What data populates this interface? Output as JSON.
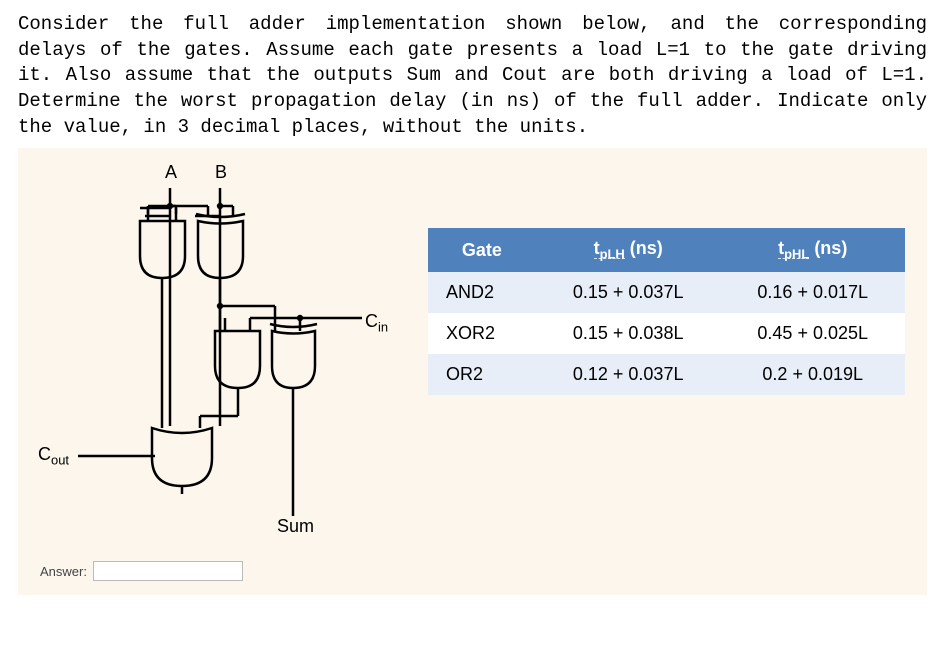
{
  "question": "Consider the full adder implementation shown below, and the corresponding delays of the gates. Assume each gate presents a load L=1 to the gate driving it. Also assume that the outputs Sum and Cout are both driving a load of L=1. Determine the worst propagation delay (in ns) of the full adder. Indicate only the value, in 3 decimal places, without the units.",
  "circuit": {
    "input_a": "A",
    "input_b": "B",
    "input_cin": "Cin",
    "output_cout": "Cout",
    "output_sum": "Sum"
  },
  "table": {
    "headers": {
      "gate": "Gate",
      "tplh_label": "tpLH (ns)",
      "tphl_label": "tpHL (ns)"
    },
    "rows": [
      {
        "gate": "AND2",
        "tplh": "0.15 + 0.037L",
        "tphl": "0.16 + 0.017L"
      },
      {
        "gate": "XOR2",
        "tplh": "0.15 + 0.038L",
        "tphl": "0.45 + 0.025L"
      },
      {
        "gate": "OR2",
        "tplh": "0.12 + 0.037L",
        "tphl": "0.2 + 0.019L"
      }
    ]
  },
  "answer": {
    "label": "Answer:",
    "value": ""
  }
}
